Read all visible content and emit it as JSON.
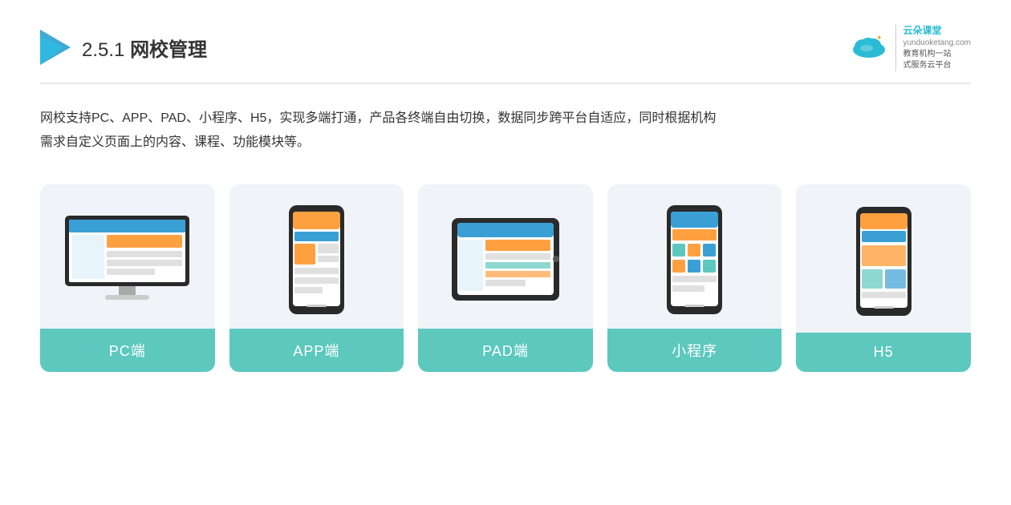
{
  "header": {
    "section_number": "2.5.1",
    "title_plain": "网校管理",
    "brand_name": "云朵课堂",
    "brand_site": "yunduoketang.com",
    "brand_tagline1": "教育机构一站",
    "brand_tagline2": "式服务云平台"
  },
  "description": {
    "line1": "网校支持PC、APP、PAD、小程序、H5，实现多端打通，产品各终端自由切换，数据同步跨平台自适应，同时根据机构",
    "line2": "需求自定义页面上的内容、课程、功能模块等。"
  },
  "cards": [
    {
      "id": "pc",
      "label": "PC端",
      "type": "pc"
    },
    {
      "id": "app",
      "label": "APP端",
      "type": "phone"
    },
    {
      "id": "pad",
      "label": "PAD端",
      "type": "pad"
    },
    {
      "id": "mini",
      "label": "小程序",
      "type": "phone"
    },
    {
      "id": "h5",
      "label": "H5",
      "type": "phone"
    }
  ],
  "accent_color": "#5cc8be",
  "bg_card": "#eef2f7"
}
